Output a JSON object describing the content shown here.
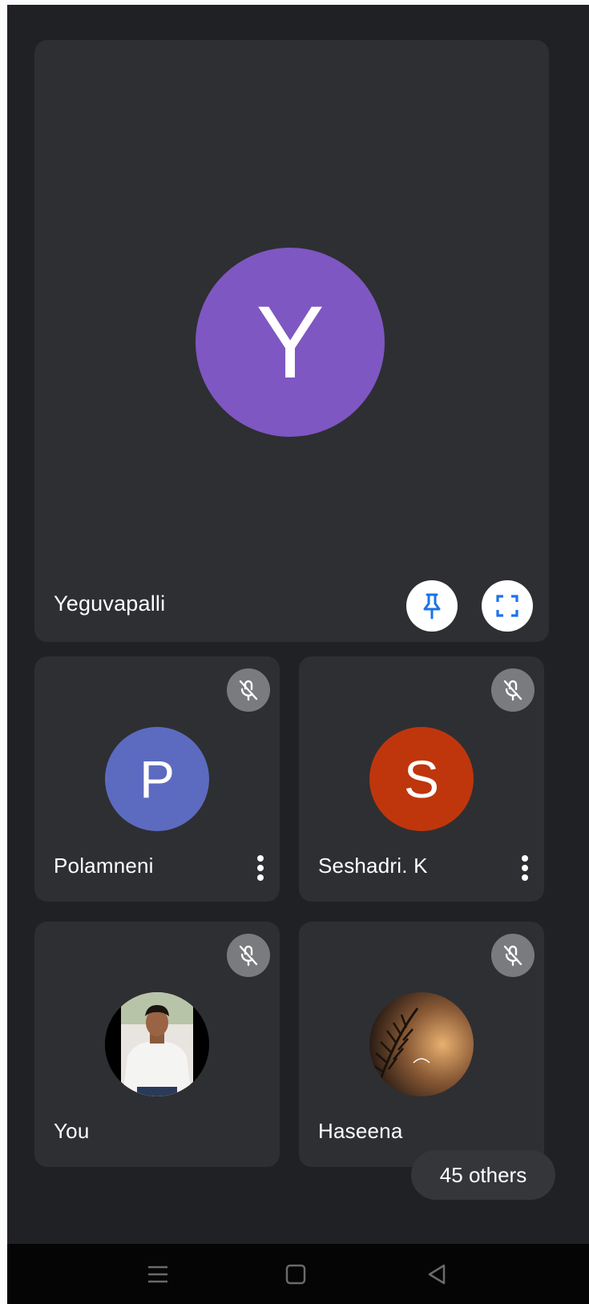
{
  "main_tile": {
    "initial": "Y",
    "name": "Yeguvapalli",
    "avatar_color": "#7e57c2",
    "pin_icon": "pin-icon",
    "fullscreen_icon": "fullscreen-icon",
    "accent": "#1a73e8"
  },
  "participants": [
    {
      "initial": "P",
      "name": "Polamneni",
      "avatar_color": "#5c6bc0",
      "muted": true,
      "more_icon": "more-vert-icon"
    },
    {
      "initial": "S",
      "name": "Seshadri. K",
      "avatar_color": "#bf360c",
      "muted": true,
      "more_icon": "more-vert-icon"
    },
    {
      "name": "You",
      "muted": true,
      "avatar": "profile-photo"
    },
    {
      "name": "Haseena",
      "muted": true,
      "avatar": "profile-photo"
    }
  ],
  "others_label": "45 others",
  "nav": {
    "icons": [
      "menu-icon",
      "home-square-icon",
      "back-triangle-icon"
    ]
  }
}
